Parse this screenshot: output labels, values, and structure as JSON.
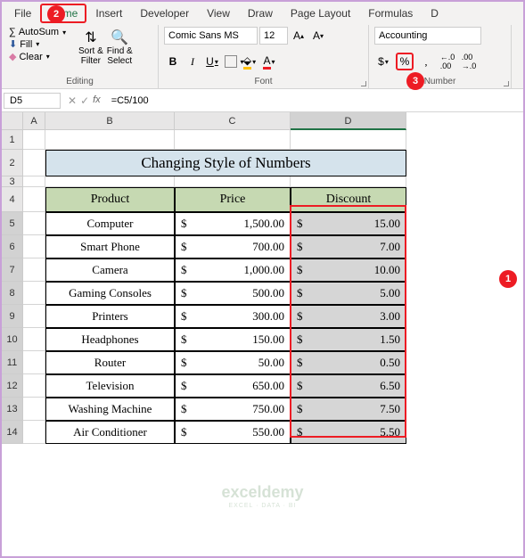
{
  "menu": {
    "items": [
      "File",
      "Home",
      "Insert",
      "Developer",
      "View",
      "Draw",
      "Page Layout",
      "Formulas"
    ],
    "active": "Home"
  },
  "ribbon": {
    "editing": {
      "autosum": "AutoSum",
      "fill": "Fill",
      "clear": "Clear",
      "sort": "Sort &\nFilter",
      "find": "Find &\nSelect",
      "label": "Editing"
    },
    "font": {
      "name": "Comic Sans MS",
      "size": "12",
      "label": "Font"
    },
    "number": {
      "format": "Accounting",
      "label": "Number"
    }
  },
  "cellbar": {
    "ref": "D5",
    "formula": "=C5/100"
  },
  "grid": {
    "title": "Changing Style of Numbers",
    "headers": {
      "product": "Product",
      "price": "Price",
      "discount": "Discount"
    },
    "rows": [
      {
        "product": "Computer",
        "price": "1,500.00",
        "discount": "15.00"
      },
      {
        "product": "Smart Phone",
        "price": "700.00",
        "discount": "7.00"
      },
      {
        "product": "Camera",
        "price": "1,000.00",
        "discount": "10.00"
      },
      {
        "product": "Gaming Consoles",
        "price": "500.00",
        "discount": "5.00"
      },
      {
        "product": "Printers",
        "price": "300.00",
        "discount": "3.00"
      },
      {
        "product": "Headphones",
        "price": "150.00",
        "discount": "1.50"
      },
      {
        "product": "Router",
        "price": "50.00",
        "discount": "0.50"
      },
      {
        "product": "Television",
        "price": "650.00",
        "discount": "6.50"
      },
      {
        "product": "Washing Machine",
        "price": "750.00",
        "discount": "7.50"
      },
      {
        "product": "Air Conditioner",
        "price": "550.00",
        "discount": "5.50"
      }
    ],
    "currency": "$",
    "cols": [
      "A",
      "B",
      "C",
      "D"
    ],
    "last_col": "D"
  },
  "callouts": {
    "c1": "1",
    "c2": "2",
    "c3": "3"
  },
  "watermark": "exceldemy",
  "watermark_sub": "EXCEL · DATA · BI"
}
